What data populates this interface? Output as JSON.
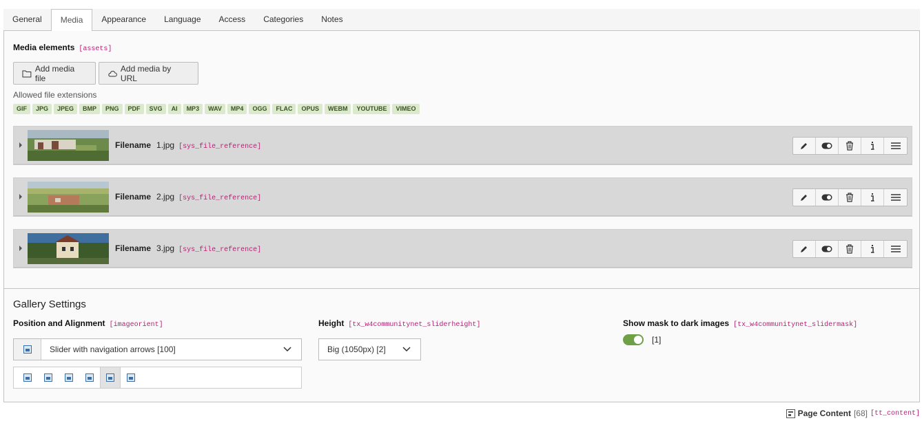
{
  "tabs": [
    "General",
    "Media",
    "Appearance",
    "Language",
    "Access",
    "Categories",
    "Notes"
  ],
  "active_tab": "Media",
  "media": {
    "label": "Media elements",
    "code": "[assets]",
    "add_file_label": "Add media file",
    "add_url_label": "Add media by URL",
    "allowed_label": "Allowed file extensions",
    "extensions": [
      "GIF",
      "JPG",
      "JPEG",
      "BMP",
      "PNG",
      "PDF",
      "SVG",
      "AI",
      "MP3",
      "WAV",
      "MP4",
      "OGG",
      "FLAC",
      "OPUS",
      "WEBM",
      "YOUTUBE",
      "VIMEO"
    ],
    "files": [
      {
        "label": "Filename",
        "name": "1.jpg",
        "code": "[sys_file_reference]"
      },
      {
        "label": "Filename",
        "name": "2.jpg",
        "code": "[sys_file_reference]"
      },
      {
        "label": "Filename",
        "name": "3.jpg",
        "code": "[sys_file_reference]"
      }
    ]
  },
  "gallery": {
    "title": "Gallery Settings",
    "position_label": "Position and Alignment",
    "position_code": "[imageorient]",
    "position_value": "Slider with navigation arrows [100]",
    "height_label": "Height",
    "height_code": "[tx_w4communitynet_sliderheight]",
    "height_value": "Big (1050px) [2]",
    "mask_label": "Show mask to dark images",
    "mask_code": "[tx_w4communitynet_slidermask]",
    "mask_value": "[1]",
    "mask_on": true
  },
  "footer": {
    "label": "Page Content",
    "id": "[68]",
    "code": "[tt_content]"
  },
  "colors": {
    "accent": "#b61f74",
    "toggle": "#6fa047",
    "ext_bg": "#dbe9cc"
  }
}
